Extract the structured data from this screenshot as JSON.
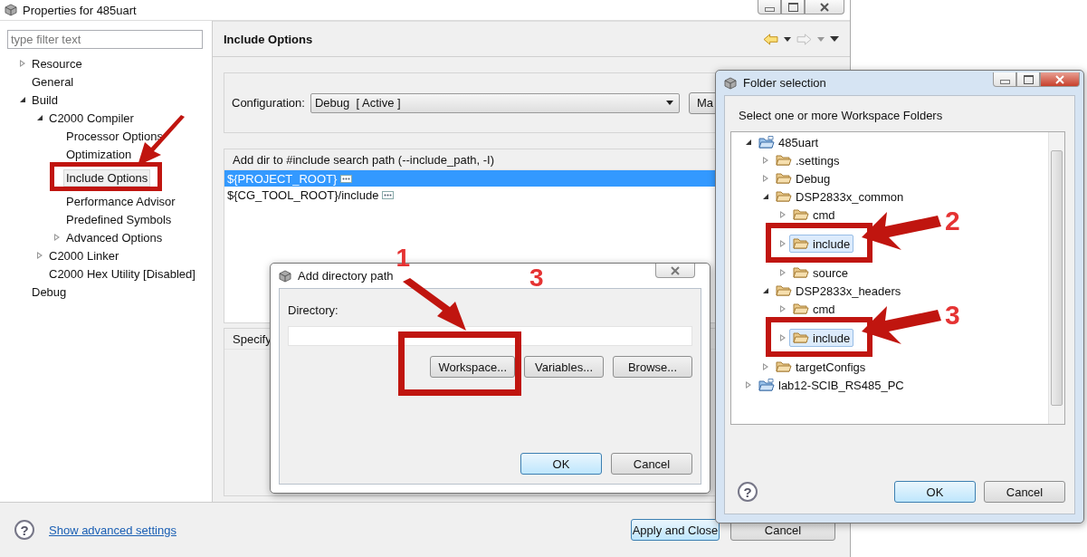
{
  "window": {
    "title": "Properties for 485uart"
  },
  "filter": {
    "placeholder": "type filter text"
  },
  "nav_tree": [
    {
      "label": "Resource",
      "expanded": false,
      "selected": false
    },
    {
      "label": "General",
      "selected": false
    },
    {
      "label": "Build",
      "expanded": true,
      "selected": false,
      "children": [
        {
          "label": "C2000 Compiler",
          "expanded": true,
          "selected": false,
          "children": [
            {
              "label": "Processor Options",
              "selected": false
            },
            {
              "label": "Optimization",
              "selected": false
            },
            {
              "label": "Include Options",
              "selected": true,
              "highlighted": true
            },
            {
              "label": "Performance Advisor",
              "selected": false
            },
            {
              "label": "Predefined Symbols",
              "selected": false
            },
            {
              "label": "Advanced Options",
              "expanded": false,
              "selected": false
            }
          ]
        },
        {
          "label": "C2000 Linker",
          "expanded": false,
          "selected": false
        },
        {
          "label": "C2000 Hex Utility  [Disabled]",
          "selected": false
        }
      ]
    },
    {
      "label": "Debug",
      "selected": false
    }
  ],
  "page": {
    "title": "Include Options",
    "configuration": {
      "label": "Configuration:",
      "value": "Debug  [ Active ]",
      "button": "Ma"
    },
    "include_list": {
      "heading": "Add dir to #include search path (--include_path, -I)",
      "rows": [
        {
          "path": "${PROJECT_ROOT}",
          "selected": true
        },
        {
          "path": "${CG_TOOL_ROOT}/include",
          "selected": false
        }
      ]
    },
    "section_2": {
      "heading": "Specify"
    }
  },
  "footer": {
    "help": "?",
    "link": "Show advanced settings",
    "buttons": [
      {
        "label": "Apply and Close",
        "default": true
      },
      {
        "label": "Cancel",
        "default": false
      }
    ]
  },
  "add_dialog": {
    "title": "Add directory path",
    "mark": "3",
    "field_label": "Directory:",
    "buttons": [
      {
        "label": "Workspace...",
        "highlighted": true,
        "callout": "1"
      },
      {
        "label": "Variables..."
      },
      {
        "label": "Browse..."
      }
    ],
    "actions": [
      {
        "label": "OK",
        "default": true
      },
      {
        "label": "Cancel",
        "default": false
      }
    ]
  },
  "folder_dialog": {
    "title": "Folder selection",
    "prompt": "Select one or more Workspace Folders",
    "tree": [
      {
        "label": "485uart",
        "kind": "project",
        "expanded": true,
        "selected": false,
        "children": [
          {
            "label": ".settings",
            "kind": "folder",
            "expanded": false,
            "selected": false
          },
          {
            "label": "Debug",
            "kind": "folder",
            "expanded": false,
            "selected": false
          },
          {
            "label": "DSP2833x_common",
            "kind": "folder",
            "expanded": true,
            "selected": false,
            "children": [
              {
                "label": "cmd",
                "kind": "folder",
                "expanded": false,
                "selected": false
              },
              {
                "label": "include",
                "kind": "folder",
                "expanded": false,
                "selected": true,
                "highlighted": true,
                "callout": "2"
              },
              {
                "label": "source",
                "kind": "folder",
                "expanded": false,
                "selected": false
              }
            ]
          },
          {
            "label": "DSP2833x_headers",
            "kind": "folder",
            "expanded": true,
            "selected": false,
            "children": [
              {
                "label": "cmd",
                "kind": "folder",
                "expanded": false,
                "selected": false
              },
              {
                "label": "include",
                "kind": "folder",
                "expanded": false,
                "selected": true,
                "highlighted": true,
                "callout": "3"
              }
            ]
          },
          {
            "label": "targetConfigs",
            "kind": "folder",
            "expanded": false,
            "selected": false
          }
        ]
      },
      {
        "label": "lab12-SCIB_RS485_PC",
        "kind": "project",
        "expanded": false,
        "selected": false
      }
    ],
    "help": "?",
    "actions": [
      {
        "label": "OK",
        "default": true
      },
      {
        "label": "Cancel",
        "default": false
      }
    ]
  }
}
